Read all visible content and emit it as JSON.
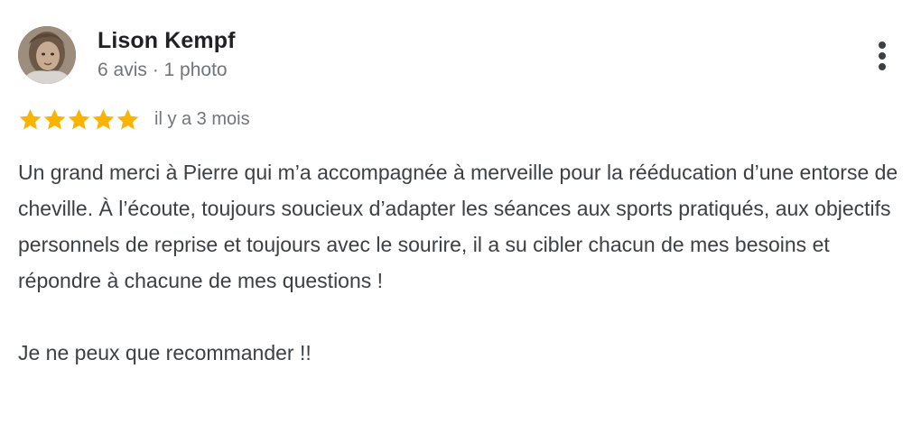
{
  "review": {
    "author": {
      "name": "Lison Kempf",
      "meta": "6 avis · 1 photo",
      "avatar_icon": "user-photo"
    },
    "rating": {
      "stars": 5,
      "max": 5,
      "star_color": "#f8b400",
      "date": "il y a 3 mois"
    },
    "text": {
      "paragraph1": "Un grand merci à Pierre qui m’a accompagnée à merveille pour la rééducation d’une entorse de cheville. À l’écoute, toujours soucieux d’adapter les séances aux sports pratiqués, aux objectifs personnels de reprise et toujours avec le sourire, il a su cibler chacun de mes besoins et répondre à chacune de mes questions !",
      "paragraph2": "Je ne peux que recommander !!"
    },
    "menu_icon": "more-vert"
  }
}
